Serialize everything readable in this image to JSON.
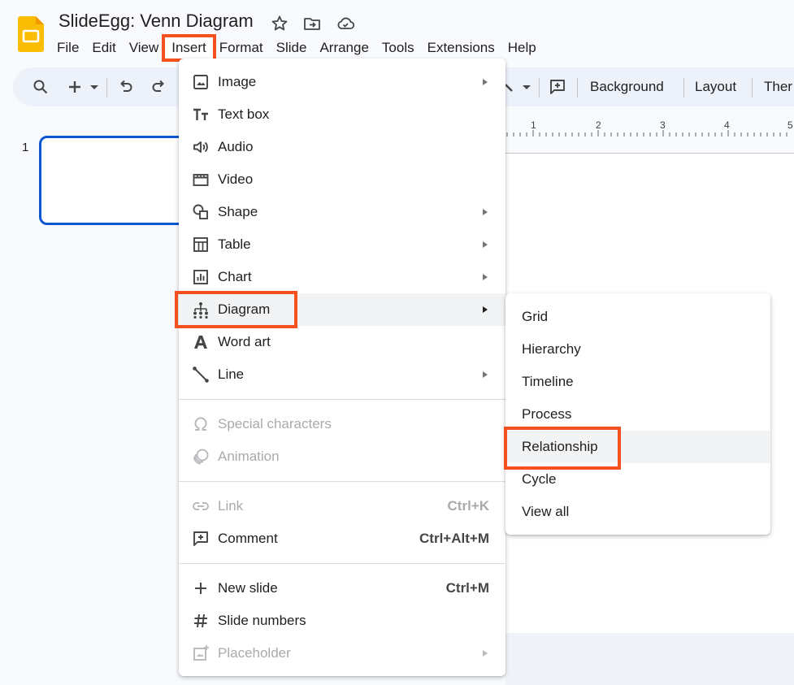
{
  "header": {
    "title": "SlideEgg: Venn Diagram",
    "menus": [
      "File",
      "Edit",
      "View",
      "Insert",
      "Format",
      "Slide",
      "Arrange",
      "Tools",
      "Extensions",
      "Help"
    ],
    "active_menu": "Insert"
  },
  "toolbar": {
    "background_label": "Background",
    "layout_label": "Layout",
    "theme_label": "Ther"
  },
  "filmstrip": {
    "slide_number": "1"
  },
  "ruler": {
    "ticks": [
      "1",
      "2",
      "3",
      "4",
      "5"
    ]
  },
  "insert_menu": {
    "items": [
      {
        "label": "Image",
        "icon": "image-icon",
        "submenu": true
      },
      {
        "label": "Text box",
        "icon": "text-box-icon"
      },
      {
        "label": "Audio",
        "icon": "audio-icon"
      },
      {
        "label": "Video",
        "icon": "video-icon"
      },
      {
        "label": "Shape",
        "icon": "shape-icon",
        "submenu": true
      },
      {
        "label": "Table",
        "icon": "table-icon",
        "submenu": true
      },
      {
        "label": "Chart",
        "icon": "chart-icon",
        "submenu": true
      },
      {
        "label": "Diagram",
        "icon": "diagram-icon",
        "submenu": true,
        "highlighted": true
      },
      {
        "label": "Word art",
        "icon": "word-art-icon"
      },
      {
        "label": "Line",
        "icon": "line-icon",
        "submenu": true
      },
      {
        "label": "Special characters",
        "icon": "omega-icon",
        "disabled": true
      },
      {
        "label": "Animation",
        "icon": "animation-icon",
        "disabled": true
      },
      {
        "label": "Link",
        "icon": "link-icon",
        "shortcut": "Ctrl+K",
        "disabled": true
      },
      {
        "label": "Comment",
        "icon": "comment-icon",
        "shortcut": "Ctrl+Alt+M"
      },
      {
        "label": "New slide",
        "icon": "plus-icon",
        "shortcut": "Ctrl+M"
      },
      {
        "label": "Slide numbers",
        "icon": "hash-icon"
      },
      {
        "label": "Placeholder",
        "icon": "placeholder-icon",
        "submenu": true,
        "disabled": true
      }
    ]
  },
  "diagram_submenu": {
    "items": [
      "Grid",
      "Hierarchy",
      "Timeline",
      "Process",
      "Relationship",
      "Cycle",
      "View all"
    ],
    "highlighted": "Relationship"
  },
  "colors": {
    "accent_highlight": "#f4511e",
    "selection_blue": "#0b57d0",
    "logo_yellow": "#fbbc04"
  }
}
